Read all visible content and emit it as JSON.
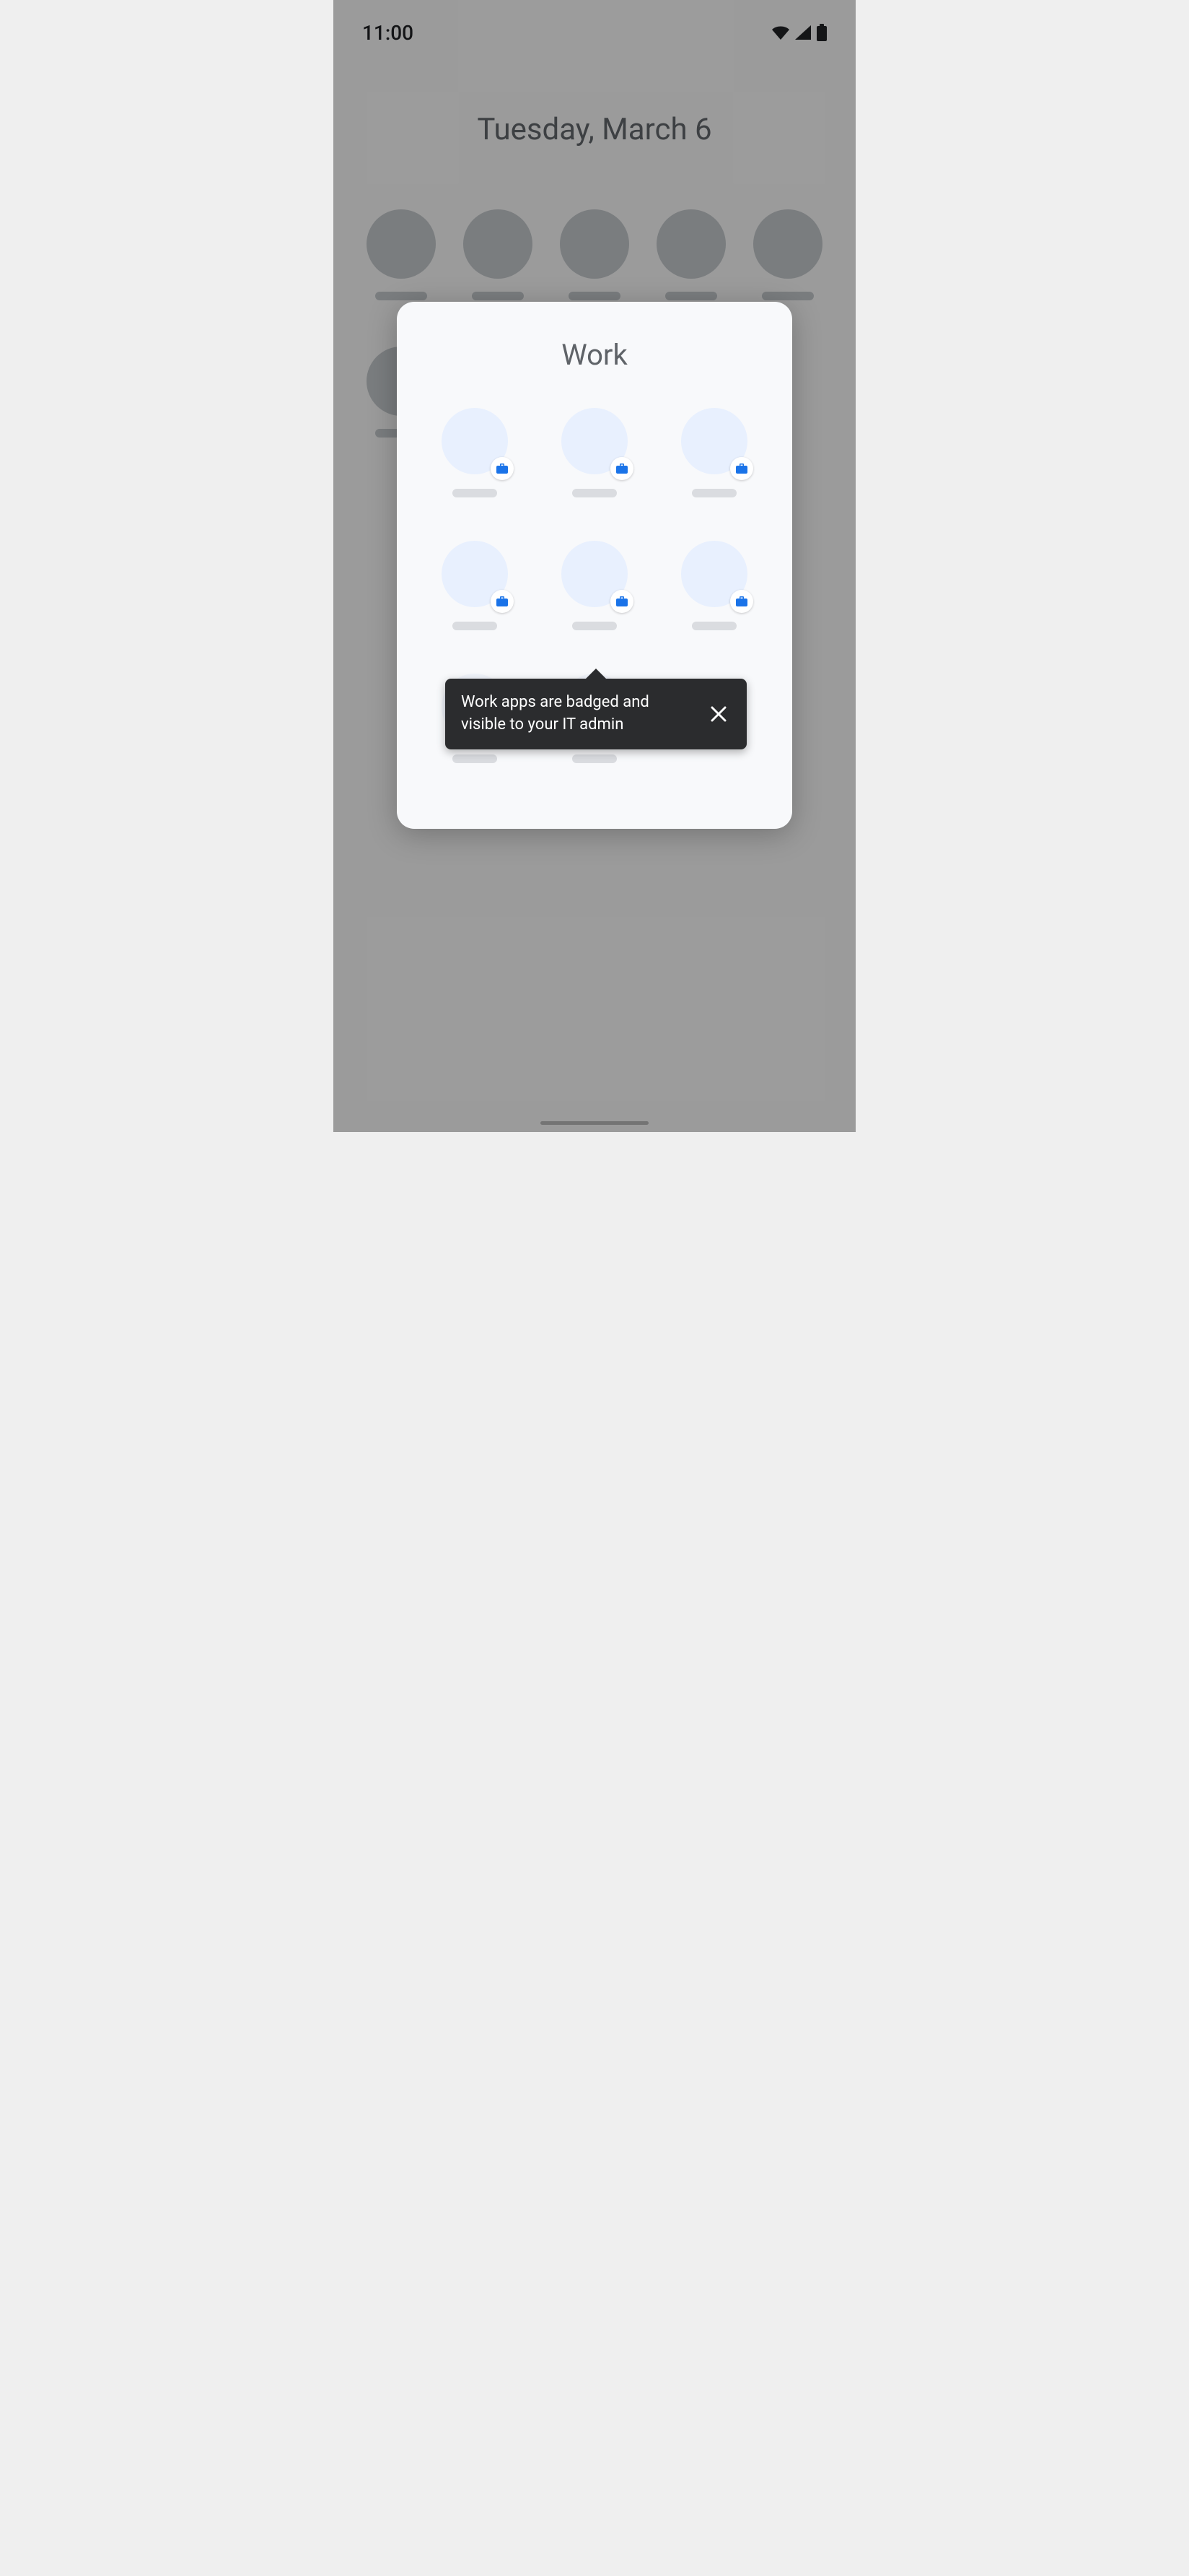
{
  "status": {
    "time": "11:00"
  },
  "home": {
    "date": "Tuesday, March 6"
  },
  "folder": {
    "title": "Work"
  },
  "tooltip": {
    "text": "Work apps are badged and visible to your IT admin"
  },
  "icons": {
    "wifi": "wifi-icon",
    "signal": "signal-icon",
    "battery": "battery-icon",
    "briefcase": "briefcase-icon",
    "close": "close-icon"
  }
}
